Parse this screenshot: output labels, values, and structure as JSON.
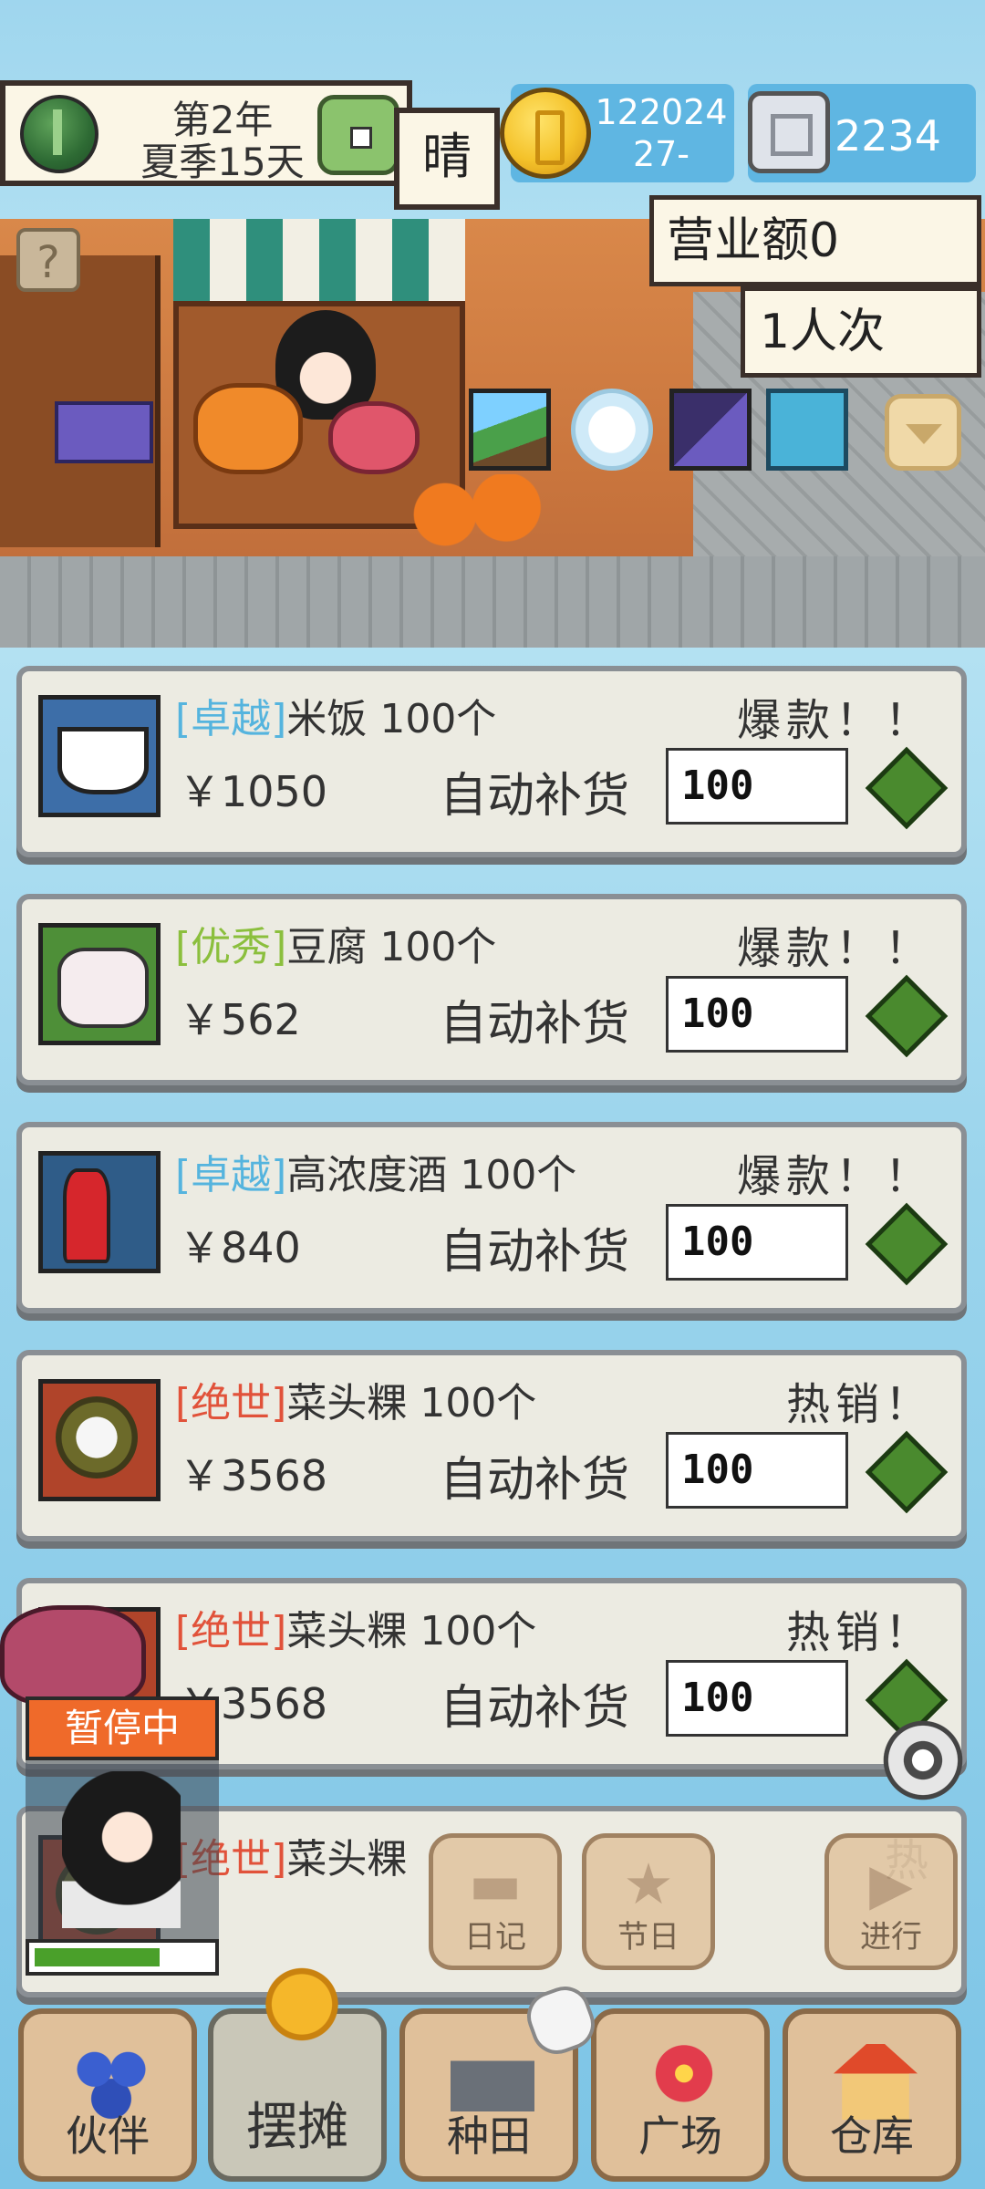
{
  "hud": {
    "date_year": "第2年",
    "date_day": "夏季15天",
    "weather": "晴",
    "coins": "122024\n27-",
    "gems": "2234",
    "icons": [
      "melon-icon",
      "dice-icon",
      "coin-icon",
      "gem-icon"
    ]
  },
  "shop": {
    "sales": "营业额0",
    "visitors": "1人次",
    "help": "?",
    "tools": [
      "map-icon",
      "feather-icon",
      "wand-icon",
      "scroll-icon",
      "chevron-down-icon"
    ]
  },
  "products": [
    {
      "quality": "[卓越]",
      "quality_color": "#55b4de",
      "name": "米饭 100个",
      "tag": "爆款！！",
      "price": "￥1050",
      "auto": "自动补货",
      "qty": "100",
      "icon": "rice-bowl-icon"
    },
    {
      "quality": "[优秀]",
      "quality_color": "#8bbf3d",
      "name": "豆腐 100个",
      "tag": "爆款！！",
      "price": "￥562",
      "auto": "自动补货",
      "qty": "100",
      "icon": "tofu-icon"
    },
    {
      "quality": "[卓越]",
      "quality_color": "#55b4de",
      "name": "高浓度酒 100个",
      "tag": "爆款！！",
      "price": "￥840",
      "auto": "自动补货",
      "qty": "100",
      "icon": "wine-bottle-icon"
    },
    {
      "quality": "[绝世]",
      "quality_color": "#e1523a",
      "name": "菜头粿 100个",
      "tag": "热销！",
      "price": "￥3568",
      "auto": "自动补货",
      "qty": "100",
      "icon": "radish-cake-icon"
    },
    {
      "quality": "[绝世]",
      "quality_color": "#e1523a",
      "name": "菜头粿 100个",
      "tag": "热销！",
      "price": "￥3568",
      "auto": "自动补货",
      "qty": "100",
      "icon": "radish-cake-icon"
    },
    {
      "quality": "[绝世]",
      "quality_color": "#e1523a",
      "name": "菜头粿",
      "tag": "热",
      "price": "",
      "auto": "",
      "qty": "",
      "icon": "radish-cake-icon"
    }
  ],
  "npc": {
    "status": "暂停中",
    "energy": 0.7
  },
  "actions": {
    "diary": "日记",
    "festival": "节日",
    "proceed": "进行"
  },
  "nav": {
    "partner": "伙伴",
    "stall": "摆摊",
    "farm": "种田",
    "plaza": "广场",
    "storage": "仓库"
  },
  "colors": {
    "accent_orange": "#ef6a2a",
    "confirm_green": "#4a8a2e",
    "sky_blue": "#9fd6ee"
  }
}
